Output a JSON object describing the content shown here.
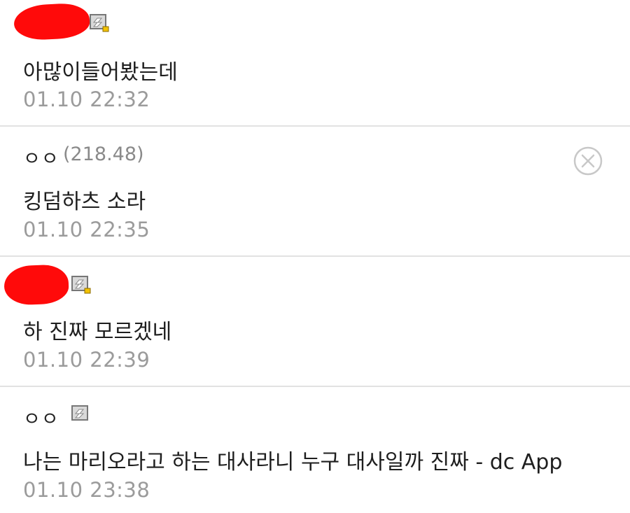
{
  "comments": [
    {
      "nickname": "",
      "ip": "",
      "text": "아많이들어봤는데",
      "date": "01.10 22:32",
      "nickname_redacted": true,
      "has_gallog_icon": true,
      "has_delete_button": false
    },
    {
      "nickname": "ㅇㅇ",
      "ip": "(218.48)",
      "text": "킹덤하츠 소라",
      "date": "01.10 22:35",
      "nickname_redacted": false,
      "has_gallog_icon": false,
      "has_delete_button": true
    },
    {
      "nickname": "",
      "ip": "",
      "text": "하 진짜 모르겠네",
      "date": "01.10 22:39",
      "nickname_redacted": true,
      "has_gallog_icon": true,
      "has_delete_button": false
    },
    {
      "nickname": "ㅇㅇ",
      "ip": "",
      "text": "나는 마리오라고 하는 대사라니 누구 대사일까 진짜 - dc App",
      "date": "01.10 23:38",
      "nickname_redacted": false,
      "has_gallog_icon": true,
      "has_delete_button": false
    }
  ],
  "colors": {
    "redaction": "#ff0a0a",
    "date_text": "#9b9b9b",
    "ip_text": "#8a8a8a",
    "divider": "#e2e2e2",
    "delete_icon": "#c8c8c8"
  },
  "icons": {
    "gallog": "gallog-icon",
    "delete": "delete-icon"
  }
}
